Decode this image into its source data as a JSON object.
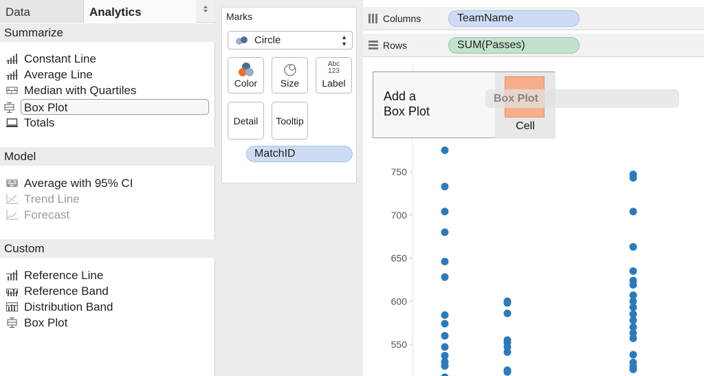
{
  "left_pane": {
    "tabs": {
      "data": "Data",
      "analytics": "Analytics",
      "menu_icon": "dropdown-arrow-icon"
    },
    "sections": [
      {
        "title": "Summarize",
        "items": [
          {
            "label": "Constant Line",
            "icon": "constant-line-icon",
            "enabled": true
          },
          {
            "label": "Average Line",
            "icon": "average-line-icon",
            "enabled": true
          },
          {
            "label": "Median with Quartiles",
            "icon": "median-quartiles-icon",
            "enabled": true
          },
          {
            "label": "Box Plot",
            "icon": "box-plot-icon",
            "enabled": true,
            "selected": true
          },
          {
            "label": "Totals",
            "icon": "totals-icon",
            "enabled": true
          }
        ]
      },
      {
        "title": "Model",
        "items": [
          {
            "label": "Average with 95% CI",
            "icon": "average-ci-icon",
            "enabled": true
          },
          {
            "label": "Trend Line",
            "icon": "trend-line-icon",
            "enabled": false
          },
          {
            "label": "Forecast",
            "icon": "forecast-icon",
            "enabled": false
          }
        ]
      },
      {
        "title": "Custom",
        "items": [
          {
            "label": "Reference Line",
            "icon": "reference-line-icon",
            "enabled": true
          },
          {
            "label": "Reference Band",
            "icon": "reference-band-icon",
            "enabled": true
          },
          {
            "label": "Distribution Band",
            "icon": "distribution-band-icon",
            "enabled": true
          },
          {
            "label": "Box Plot",
            "icon": "box-plot-icon",
            "enabled": true
          }
        ]
      }
    ]
  },
  "marks": {
    "title": "Marks",
    "mark_type": "Circle",
    "buttons": {
      "color": "Color",
      "size": "Size",
      "label": "Label",
      "detail": "Detail",
      "tooltip": "Tooltip"
    },
    "label_icon_text": {
      "top": "Abc",
      "bottom": "123"
    },
    "pill": "MatchID"
  },
  "shelves": {
    "columns": {
      "label": "Columns",
      "pill": "TeamName"
    },
    "rows": {
      "label": "Rows",
      "pill": "SUM(Passes)"
    }
  },
  "drop_tooltip": {
    "line1": "Add a",
    "line2": "Box Plot",
    "cell": "Cell",
    "drag_ghost": "Box Plot"
  },
  "colors": {
    "mark": "#2b7bba",
    "dimension_pill": "#cddcf4",
    "measure_pill": "#c2e2cd",
    "drop_target": "#f7ae8b"
  },
  "chart_data": {
    "type": "scatter",
    "y_ticks": [
      550,
      600,
      650,
      700,
      750
    ],
    "ylim": [
      510,
      800
    ],
    "grid": false,
    "series": [
      {
        "column": 1,
        "values": [
          775,
          733,
          704,
          680,
          646,
          628,
          584,
          574,
          560,
          547,
          537,
          530,
          525,
          512
        ]
      },
      {
        "column": 2,
        "values": [
          600,
          598,
          586,
          555,
          552,
          547,
          541,
          520,
          518
        ]
      },
      {
        "column": 3,
        "values": [
          747,
          743,
          704,
          663,
          635,
          624,
          619,
          607,
          600,
          593,
          585,
          578,
          570,
          563,
          557,
          538,
          529,
          524,
          521
        ]
      }
    ]
  }
}
